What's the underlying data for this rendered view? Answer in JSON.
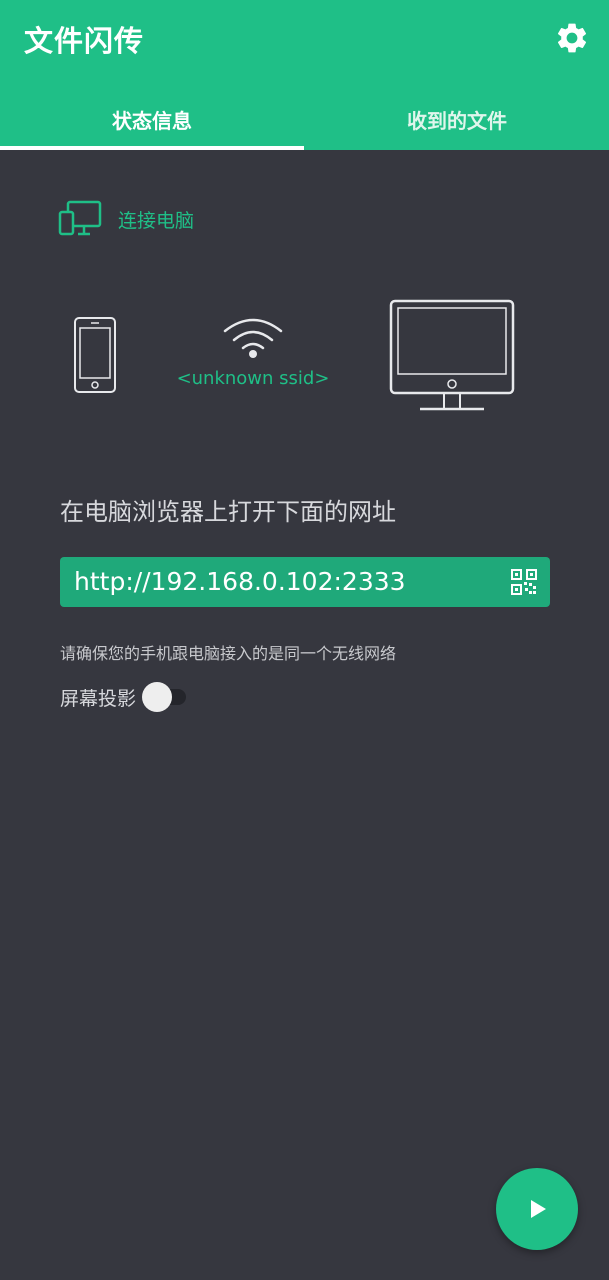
{
  "app": {
    "title": "文件闪传",
    "settings_icon": "gear-icon",
    "accent_color": "#1fbf87"
  },
  "tabs": [
    {
      "label": "状态信息",
      "selected": true
    },
    {
      "label": "收到的文件",
      "selected": false
    }
  ],
  "connection": {
    "section_label": "连接电脑",
    "section_icon": "devices-icon",
    "ssid": "<unknown ssid>",
    "phone_icon": "phone-icon",
    "wifi_icon": "wifi-icon",
    "monitor_icon": "monitor-icon"
  },
  "instructions": "在电脑浏览器上打开下面的网址",
  "url": {
    "value": "http://192.168.0.102:2333",
    "qr_icon": "qr-code-icon"
  },
  "note": "请确保您的手机跟电脑接入的是同一个无线网络",
  "screen_projection": {
    "label": "屏幕投影",
    "enabled": false
  },
  "fab": {
    "icon": "play-icon"
  }
}
